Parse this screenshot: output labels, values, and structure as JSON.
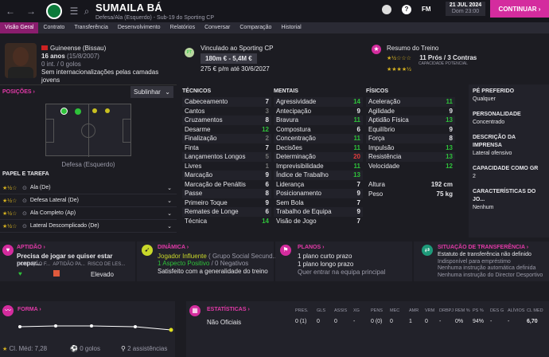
{
  "header": {
    "name": "SUMAILA BÁ",
    "subtitle": "Defesa/Ala (Esquerdo) - Sub-19 do Sporting CP",
    "date": "21 JUL 2024",
    "day_time": "Dom 23:00",
    "continue": "CONTINUAR",
    "fm": "FM"
  },
  "tabs": [
    "Visão Geral",
    "Contrato",
    "Transferência",
    "Desenvolvimento",
    "Relatórios",
    "Conversar",
    "Comparação",
    "Historial"
  ],
  "profile": {
    "nationality": "Guineense (Bissau)",
    "age": "16 anos",
    "dob": "(15/8/2007)",
    "intl": "0 int. / 0 golos",
    "youth": "Sem internacionalizações pelas camadas jovens"
  },
  "contract": {
    "badge": "PT",
    "club": "Vinculado ao Sporting CP",
    "value": "180m € - 5,4M €",
    "wage": "275 € p/m até 30/6/2027"
  },
  "training": {
    "title": "Resumo do Treino",
    "result": "11 Prós / 3 Contras",
    "potential_label": "CAPACIDADE POTENCIAL"
  },
  "positions": {
    "title": "POSIÇÕES",
    "button": "Sublinhar",
    "caption": "Defesa (Esquerdo)"
  },
  "roles": {
    "title": "PAPEL E TAREFA",
    "items": [
      "Ala (De)",
      "Defesa Lateral (De)",
      "Ala Completo (Ap)",
      "Lateral Descomplicado (De)"
    ]
  },
  "technical": {
    "title": "TÉCNICOS",
    "rows": [
      [
        "Cabeceamento",
        "7"
      ],
      [
        "Cantos",
        "3"
      ],
      [
        "Cruzamentos",
        "8"
      ],
      [
        "Desarme",
        "12"
      ],
      [
        "Finalização",
        "2"
      ],
      [
        "Finta",
        "7"
      ],
      [
        "Lançamentos Longos",
        "5"
      ],
      [
        "Livres",
        "1"
      ],
      [
        "Marcação",
        "9"
      ],
      [
        "Marcação de Penáltis",
        "6"
      ],
      [
        "Passe",
        "8"
      ],
      [
        "Primeiro Toque",
        "9"
      ],
      [
        "Remates de Longe",
        "6"
      ],
      [
        "Técnica",
        "14"
      ]
    ]
  },
  "mental": {
    "title": "MENTAIS",
    "rows": [
      [
        "Agressividade",
        "14"
      ],
      [
        "Antecipação",
        "9"
      ],
      [
        "Bravura",
        "11"
      ],
      [
        "Compostura",
        "6"
      ],
      [
        "Concentração",
        "11"
      ],
      [
        "Decisões",
        "11"
      ],
      [
        "Determinação",
        "20"
      ],
      [
        "Imprevisibilidade",
        "11"
      ],
      [
        "Índice de Trabalho",
        "13"
      ],
      [
        "Liderança",
        "7"
      ],
      [
        "Posicionamento",
        "9"
      ],
      [
        "Sem Bola",
        "7"
      ],
      [
        "Trabalho de Equipa",
        "9"
      ],
      [
        "Visão de Jogo",
        "7"
      ]
    ]
  },
  "physical": {
    "title": "FÍSICOS",
    "rows": [
      [
        "Aceleração",
        "11"
      ],
      [
        "Agilidade",
        "9"
      ],
      [
        "Aptidão Física",
        "13"
      ],
      [
        "Equilíbrio",
        "9"
      ],
      [
        "Força",
        "8"
      ],
      [
        "Impulsão",
        "13"
      ],
      [
        "Resistência",
        "13"
      ],
      [
        "Velocidade",
        "12"
      ]
    ],
    "height_label": "Altura",
    "height": "192 cm",
    "weight_label": "Peso",
    "weight": "75 kg"
  },
  "info": [
    [
      "PÉ PREFERIDO",
      "Qualquer"
    ],
    [
      "PERSONALIDADE",
      "Concentrado"
    ],
    [
      "DESCRIÇÃO DA IMPRENSA",
      "Lateral ofensivo"
    ],
    [
      "CAPACIDADE COMO GR",
      "2"
    ],
    [
      "CARACTERÍSTICAS DO JO...",
      "Nenhum"
    ]
  ],
  "cards": {
    "aptidao": {
      "title": "APTIDÃO",
      "text": "Precisa de jogar se quiser estar prepar...",
      "l1": "CONDIÇÃO F...",
      "l2": "APTIDÃO PA...",
      "l3": "RISCO DE LES...",
      "risk": "Elevado"
    },
    "dinamica": {
      "title": "DINÂMICA",
      "role": "Jogador Influente",
      "group": " ( Grupo Social Secund...",
      "pos": "1 Aspecto Positivo",
      "neg": " / 0 Negativos",
      "text": "Satisfeito com a generalidade do treino"
    },
    "planos": {
      "title": "PLANOS",
      "l1": "1 plano curto prazo",
      "l2": "1 plano longo prazo",
      "l3": "Quer entrar na equipa principal"
    },
    "transfer": {
      "title": "SITUAÇÃO DE TRANSFERÊNCIA",
      "l1": "Estatuto de transferência não definido",
      "l2": "Indisponível para empréstimo",
      "l3": "Nenhuma instrução automática definida",
      "l4": "Nenhuma instrução do Director Desportivo"
    }
  },
  "form": {
    "title": "FORMA",
    "avg": "Cl. Méd: 7,28",
    "goals": "0 golos",
    "assists": "2 assistências"
  },
  "stats": {
    "title": "ESTATÍSTICAS",
    "headers": [
      "PRES.",
      "GLS",
      "ASSIS",
      "XG",
      "PENS",
      "MEC",
      "AMR",
      "VRM",
      "DRBPJ",
      "REM %",
      "PS %",
      "DES G",
      "ALÍVIOS",
      "CL MED"
    ],
    "row_label": "Não Oficiais",
    "row": [
      "0 (1)",
      "0",
      "0",
      "-",
      "0 (0)",
      "0",
      "1",
      "0",
      "-",
      "0%",
      "94%",
      "-",
      "-",
      "6,70"
    ]
  },
  "colors": {
    "accent": "#d42c9e",
    "green": "#2ec23a",
    "yellow": "#c9c020"
  }
}
